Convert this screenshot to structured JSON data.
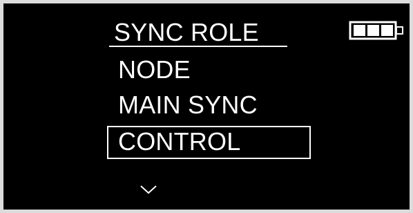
{
  "menu": {
    "title": "SYNC ROLE",
    "items": [
      {
        "label": "NODE",
        "selected": false
      },
      {
        "label": "MAIN SYNC",
        "selected": false
      },
      {
        "label": "CONTROL",
        "selected": true
      }
    ]
  },
  "status": {
    "battery_icon": "battery-icon",
    "battery_level": 1.0
  },
  "navigation": {
    "scroll_indicator_icon": "chevron-down-icon"
  },
  "colors": {
    "background": "#000000",
    "foreground": "#ffffff"
  }
}
